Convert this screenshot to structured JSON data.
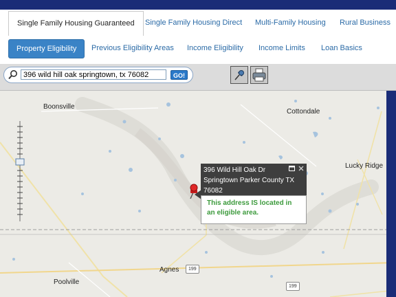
{
  "tabs_primary": [
    {
      "label": "Single Family Housing Guaranteed",
      "active": true
    },
    {
      "label": "Single Family Housing Direct",
      "active": false
    },
    {
      "label": "Multi-Family Housing",
      "active": false
    },
    {
      "label": "Rural Business",
      "active": false
    }
  ],
  "tabs_secondary": [
    {
      "label": "Property Eligibility",
      "active": true
    },
    {
      "label": "Previous Eligibility Areas",
      "active": false
    },
    {
      "label": "Income Eligibility",
      "active": false
    },
    {
      "label": "Income Limits",
      "active": false
    },
    {
      "label": "Loan Basics",
      "active": false
    }
  ],
  "search": {
    "value": "396 wild hill oak springtown, tx 76082",
    "go_label": "GO!"
  },
  "toolbar_icons": [
    "pushpin-icon",
    "printer-icon"
  ],
  "map": {
    "places": {
      "boonsville": "Boonsville",
      "cottondale": "Cottondale",
      "lucky_ridge": "Lucky Ridge",
      "agnes": "Agnes",
      "poolville": "Poolville"
    },
    "route_199_a": "199",
    "route_199_b": "199"
  },
  "popup": {
    "line1": "396 Wild Hill Oak Dr",
    "line2": "Springtown Parker County TX",
    "line3": "76082",
    "message_line1": "This address IS located in",
    "message_line2": "an eligible area."
  },
  "colors": {
    "header_navy": "#1a2c77",
    "active_tab_blue": "#3a83c6",
    "eligible_green": "#3c9a3c"
  }
}
